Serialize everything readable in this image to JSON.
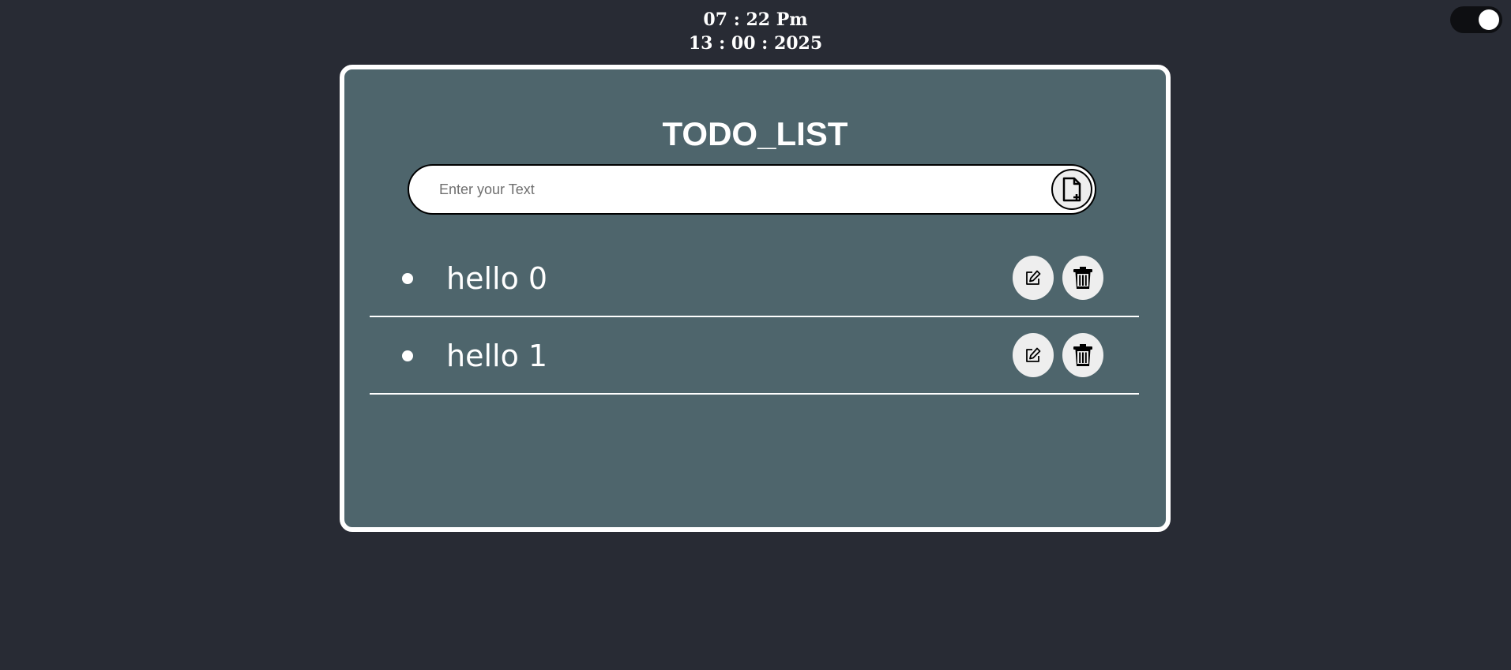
{
  "clock": {
    "time": "07 : 22 Pm",
    "date": "13 : 00 : 2025"
  },
  "theme_toggle": {
    "state": "on"
  },
  "app": {
    "title": "TODO_LIST"
  },
  "input": {
    "placeholder": "Enter your Text",
    "value": ""
  },
  "add_button": {
    "icon": "file-plus-icon"
  },
  "todos": [
    {
      "text": "hello 0",
      "edit_icon": "edit-icon",
      "delete_icon": "trash-icon"
    },
    {
      "text": "hello 1",
      "edit_icon": "edit-icon",
      "delete_icon": "trash-icon"
    }
  ],
  "colors": {
    "page_background": "#282b34",
    "card_background": "#4e656c",
    "card_border": "#ffffff",
    "text": "#ffffff",
    "button_background": "#eeeeee"
  }
}
